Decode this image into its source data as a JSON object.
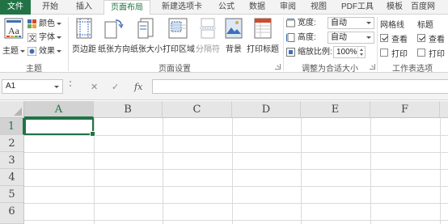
{
  "tabs": {
    "file": "文件",
    "home": "开始",
    "insert": "插入",
    "page_layout": "页面布局",
    "new_tab": "新建选项卡",
    "formulas": "公式",
    "data": "数据",
    "review": "审阅",
    "view": "视图",
    "pdf": "PDF工具",
    "template": "模板",
    "baidu": "百度网"
  },
  "ribbon": {
    "themes": {
      "theme_label": "主题",
      "colors_label": "颜色",
      "fonts_label": "字体",
      "effects_label": "效果",
      "group_label": "主题"
    },
    "page_setup": {
      "margins": "页边距",
      "orientation": "纸张方向",
      "size": "纸张大小",
      "print_area": "打印区域",
      "breaks": "分隔符",
      "background": "背景",
      "print_titles": "打印标题",
      "group_label": "页面设置"
    },
    "scale_to_fit": {
      "width_label": "宽度:",
      "width_value": "自动",
      "height_label": "高度:",
      "height_value": "自动",
      "scale_label": "缩放比例:",
      "scale_value": "100%",
      "group_label": "调整为合适大小"
    },
    "sheet_options": {
      "gridlines_label": "网格线",
      "headings_label": "标题",
      "view_label": "查看",
      "print_label": "打印",
      "gridlines_view": true,
      "gridlines_print": false,
      "headings_view": true,
      "headings_print": false,
      "group_label": "工作表选项"
    }
  },
  "formula_bar": {
    "name_box": "A1",
    "cancel_symbol": "✕",
    "enter_symbol": "✓",
    "fx_symbol": "fx",
    "formula": ""
  },
  "sheet": {
    "columns": [
      "A",
      "B",
      "C",
      "D",
      "E",
      "F"
    ],
    "rows": [
      "1",
      "2",
      "3",
      "4",
      "5",
      "6"
    ],
    "active_cell": "A1"
  },
  "colors": {
    "accent": "#217346",
    "ribbon_bg": "#ffffff",
    "tabbar_bg": "#f3f3f3",
    "header_bg": "#e6e6e6"
  }
}
